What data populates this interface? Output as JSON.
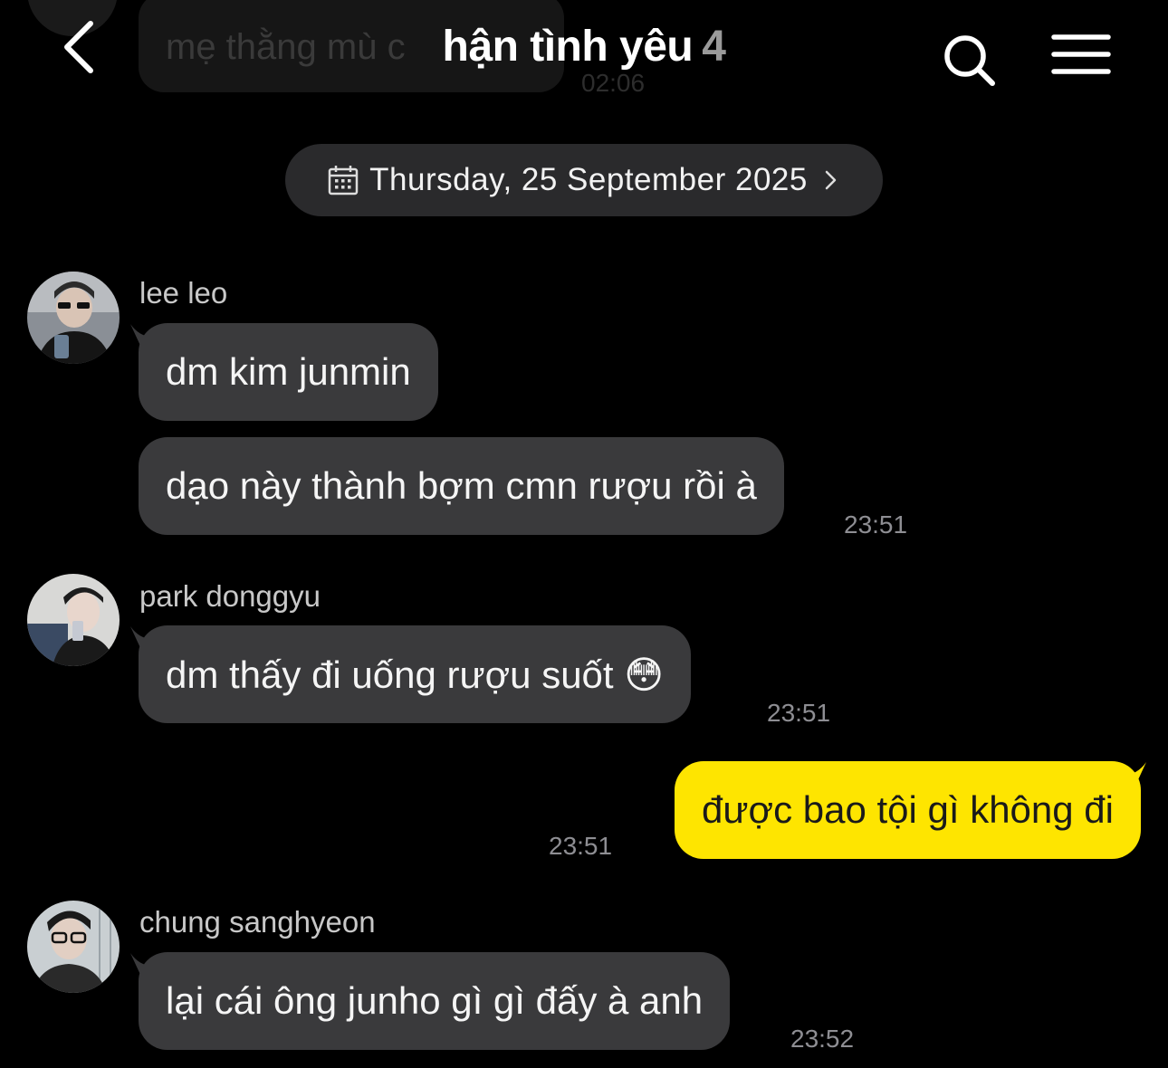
{
  "background_color": "#000000",
  "accent_color": "#fee500",
  "previous_message": {
    "text": "mẹ thằng mù c",
    "time": "02:06"
  },
  "header": {
    "title": "hận tình yêu",
    "member_count": "4",
    "back_icon": "chevron-left-icon",
    "search_icon": "search-icon",
    "menu_icon": "hamburger-menu-icon"
  },
  "date_divider": {
    "icon": "calendar-icon",
    "label": "Thursday, 25 September 2025",
    "chevron_icon": "chevron-right-icon"
  },
  "messages": [
    {
      "sender": "lee leo",
      "bubbles": [
        "dm kim junmin",
        "dạo này thành bợm cmn rượu rồi à"
      ],
      "time": "23:51"
    },
    {
      "sender": "park donggyu",
      "bubbles": [
        "dm thấy đi uống rượu suốt 😳"
      ],
      "time": "23:51"
    },
    {
      "sender": "me",
      "bubbles": [
        "được bao tội gì không đi"
      ],
      "time": "23:51"
    },
    {
      "sender": "chung sanghyeon",
      "bubbles": [
        "lại cái ông junho gì gì đấy à anh"
      ],
      "time": "23:52"
    }
  ]
}
